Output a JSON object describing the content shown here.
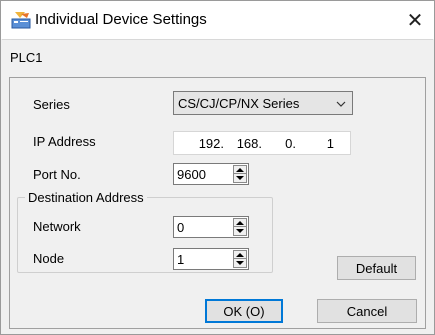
{
  "window": {
    "title": "Individual Device Settings",
    "close_glyph": "✕",
    "device_name": "PLC1"
  },
  "form": {
    "series_label": "Series",
    "series_value": "CS/CJ/CP/NX Series",
    "ip_label": "IP Address",
    "ip_segments": [
      "192.",
      "168.",
      "0.",
      "1"
    ],
    "port_label": "Port No.",
    "port_value": "9600",
    "destination_group_title": "Destination Address",
    "network_label": "Network",
    "network_value": "0",
    "node_label": "Node",
    "node_value": "1"
  },
  "buttons": {
    "default": "Default",
    "ok": "OK (O)",
    "cancel": "Cancel"
  },
  "colors": {
    "focus_border": "#0078d7",
    "window_bg": "#f0f0f0"
  }
}
